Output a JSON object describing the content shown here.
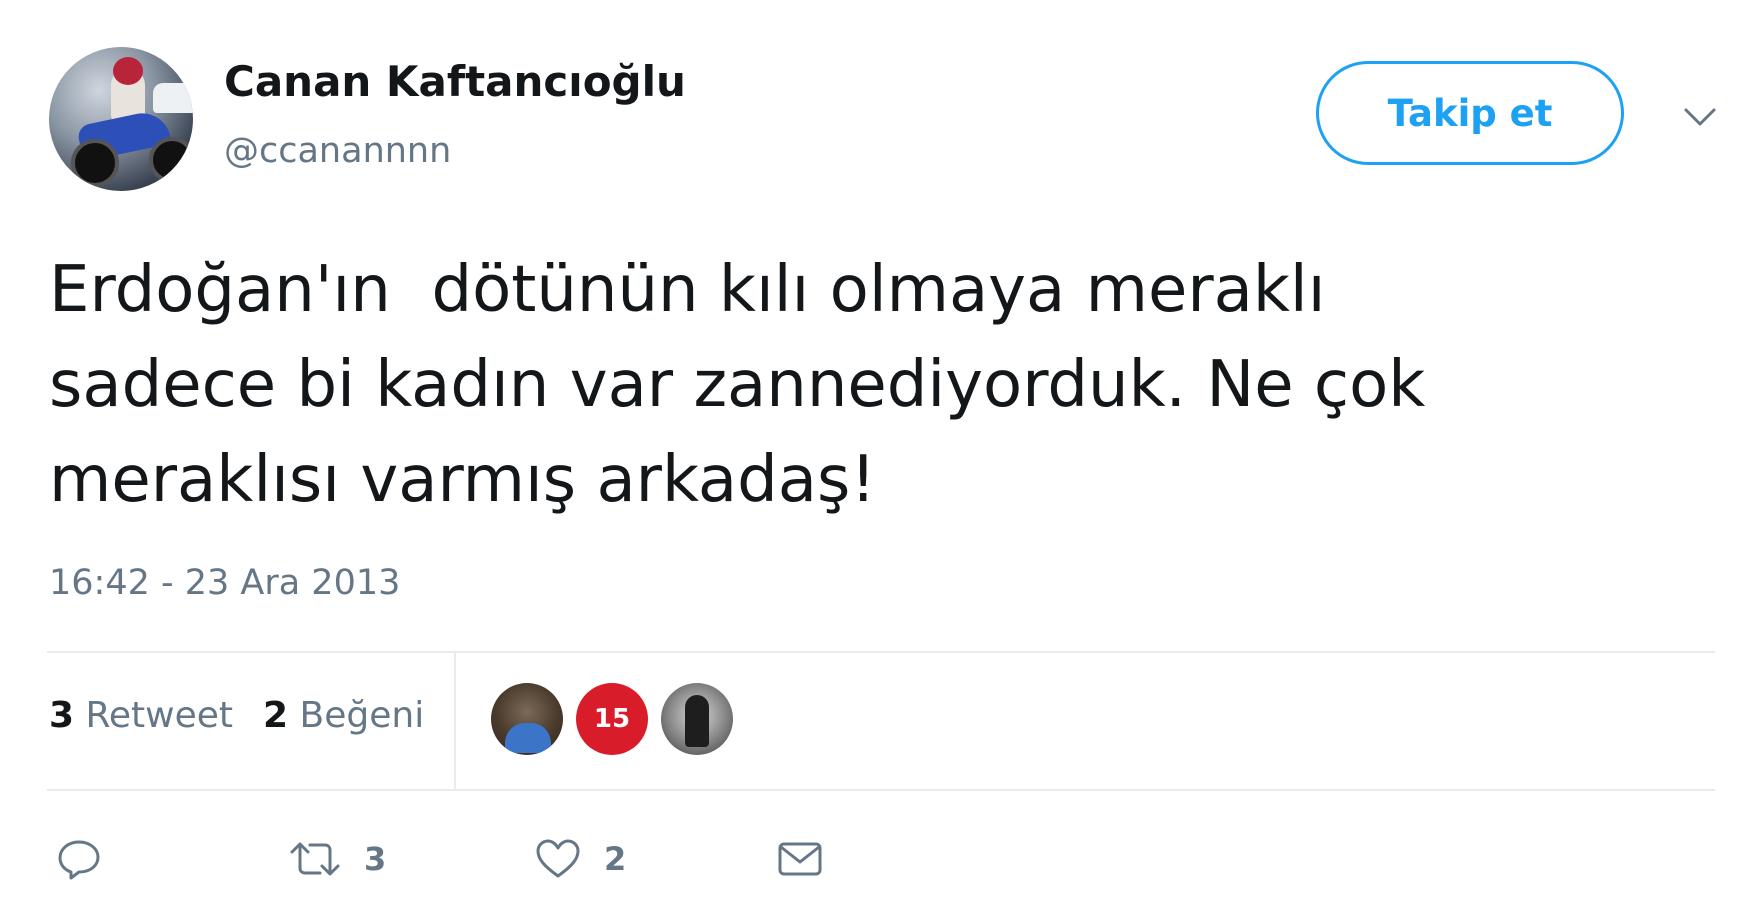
{
  "user": {
    "display_name": "Canan Kaftancıoğlu",
    "handle": "@ccanannnn",
    "avatar_icon": "motorcycle-avatar"
  },
  "follow_button": {
    "label": "Takip et",
    "color": "#1da1f2"
  },
  "menu": {
    "icon": "chevron-down-icon"
  },
  "tweet": {
    "text": "Erdoğan'ın  dötünün kılı olmaya meraklı\nsadece bi kadın var zannediyorduk. Ne çok\nmeraklısı varmış arkadaş!",
    "timestamp": "16:42 - 23 Ara 2013"
  },
  "stats": {
    "retweet_count": "3",
    "retweet_label": "Retweet",
    "like_count": "2",
    "like_label": "Beğeni"
  },
  "likers": [
    {
      "icon": "person-avatar"
    },
    {
      "icon": "15-temmuz-avatar",
      "text": "15"
    },
    {
      "icon": "person-avatar"
    }
  ],
  "actions": {
    "reply_icon": "reply-icon",
    "retweet_icon": "retweet-icon",
    "retweet_count": "3",
    "like_icon": "heart-icon",
    "like_count": "2",
    "message_icon": "envelope-icon"
  },
  "colors": {
    "text": "#14171a",
    "secondary": "#657786",
    "divider": "#e6ecf0",
    "accent": "#1da1f2"
  }
}
